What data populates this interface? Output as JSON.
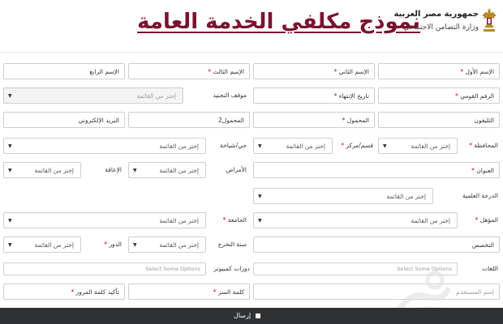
{
  "header": {
    "gov_line1": "جمهورية مصر العربية",
    "gov_line2": "وزارة التضامن الاجتماعي",
    "title": "نموذج مكلفي الخدمة العامة"
  },
  "form": {
    "first_name_label": "الإسم الأول",
    "second_name_label": "الإسم الثاني",
    "third_name_label": "الإسم الثالث",
    "fourth_name_label": "الإسم الرابع",
    "national_id_label": "الرقم القومي",
    "end_date_label": "تاريخ الإنتهاء",
    "recruitment_status_label": "موقف التجنيد",
    "phone_label": "التليفون",
    "mobile_label": "المحمول",
    "mobile2_label": "المحمول2",
    "email_label": "البريد الإلكتروني",
    "governorate_label": "المحافظة",
    "district_label": "قسم/مركز",
    "neighborhood_label": "حي/شياخة",
    "address_label": "العنوان",
    "diseases_label": "الأمراض",
    "disability_label": "الإعاقة",
    "degree_label": "الدرجة العلمية",
    "qualification_label": "المؤهل",
    "university_label": "الجامعة",
    "specialization_label": "التخصص",
    "grad_year_label": "سنة التخرج",
    "role_label": "الدور",
    "languages_label": "اللغات",
    "computer_courses_label": "دورات كمبيوتر",
    "username_label": "إسم المستخدم",
    "password_label": "كلمة السر",
    "confirm_password_label": "تأكيد كلمة المرور",
    "select_placeholder": "إختر من القائمة",
    "multi_placeholder": "Select Some Options",
    "required_mark": "*"
  },
  "submit_label": "إرسال",
  "colors": {
    "title": "#7a1230",
    "submit_bar": "#2f3133",
    "required": "#d0021b"
  },
  "icons": {
    "emblem": "eagle-emblem-icon",
    "caret": "caret-down-icon",
    "submit": "square-icon"
  }
}
